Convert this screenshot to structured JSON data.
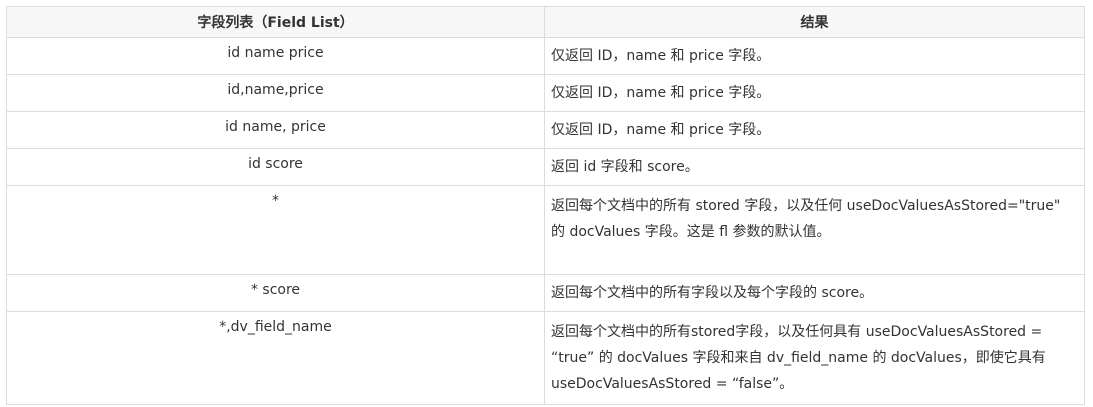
{
  "table": {
    "headers": {
      "field_list": "字段列表（Field List）",
      "result": "结果"
    },
    "rows": [
      {
        "field_list": "id name price",
        "result": "仅返回 ID，name 和 price 字段。"
      },
      {
        "field_list": "id,name,price",
        "result": "仅返回 ID，name 和 price 字段。"
      },
      {
        "field_list": "id name, price",
        "result": "仅返回 ID，name 和 price 字段。"
      },
      {
        "field_list": "id score",
        "result": "返回 id 字段和 score。"
      },
      {
        "field_list": "*",
        "result": "返回每个文档中的所有 stored 字段，以及任何 useDocValuesAsStored=\"true\" 的 docValues 字段。这是 fl 参数的默认值。"
      },
      {
        "field_list": "* score",
        "result": "返回每个文档中的所有字段以及每个字段的 score。"
      },
      {
        "field_list": "*,dv_field_name",
        "result": "返回每个文档中的所有stored字段，以及任何具有 useDocValuesAsStored = “true” 的 docValues 字段和来自 dv_field_name 的 docValues，即使它具有useDocValuesAsStored = “false”。"
      }
    ]
  }
}
